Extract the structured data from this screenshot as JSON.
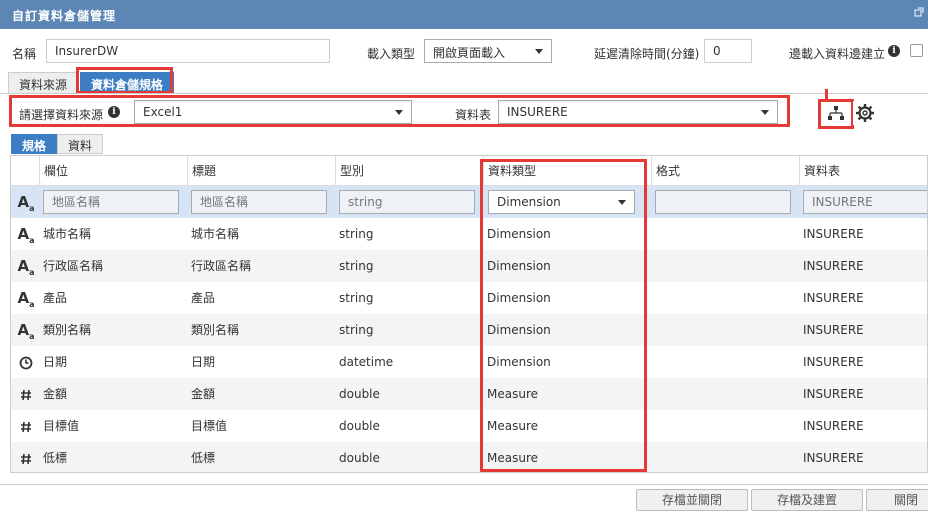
{
  "window": {
    "title": "自訂資料倉儲管理"
  },
  "form": {
    "name_label": "名稱",
    "name_value": "InsurerDW",
    "load_type_label": "載入類型",
    "load_type_value": "開啟頁面載入",
    "delay_label": "延遲清除時間(分鐘)",
    "delay_value": "0",
    "build_label": "邊載入資料邊建立",
    "build_checked": false
  },
  "tabs": [
    {
      "label": "資料來源",
      "active": false
    },
    {
      "label": "資料倉儲規格",
      "active": true
    }
  ],
  "source": {
    "select_label": "請選擇資料來源",
    "source_value": "Excel1",
    "table_label": "資料表",
    "table_value": "INSURERE"
  },
  "subtabs": [
    {
      "label": "規格",
      "active": true
    },
    {
      "label": "資料",
      "active": false
    }
  ],
  "grid": {
    "columns": [
      "欄位",
      "標題",
      "型別",
      "資料類型",
      "格式",
      "資料表"
    ],
    "filter": {
      "field": "地區名稱",
      "title": "地區名稱",
      "type": "string",
      "data_type": "Dimension",
      "format": "",
      "table": "INSURERE"
    },
    "rows": [
      {
        "icon": "text-type-icon",
        "field": "城市名稱",
        "title": "城市名稱",
        "type": "string",
        "data_type": "Dimension",
        "format": "",
        "table": "INSURERE"
      },
      {
        "icon": "text-type-icon",
        "field": "行政區名稱",
        "title": "行政區名稱",
        "type": "string",
        "data_type": "Dimension",
        "format": "",
        "table": "INSURERE"
      },
      {
        "icon": "text-type-icon",
        "field": "產品",
        "title": "產品",
        "type": "string",
        "data_type": "Dimension",
        "format": "",
        "table": "INSURERE"
      },
      {
        "icon": "text-type-icon",
        "field": "類別名稱",
        "title": "類別名稱",
        "type": "string",
        "data_type": "Dimension",
        "format": "",
        "table": "INSURERE"
      },
      {
        "icon": "clock-icon",
        "field": "日期",
        "title": "日期",
        "type": "datetime",
        "data_type": "Dimension",
        "format": "",
        "table": "INSURERE"
      },
      {
        "icon": "hash-icon",
        "field": "金額",
        "title": "金額",
        "type": "double",
        "data_type": "Measure",
        "format": "",
        "table": "INSURERE"
      },
      {
        "icon": "hash-icon",
        "field": "目標值",
        "title": "目標值",
        "type": "double",
        "data_type": "Measure",
        "format": "",
        "table": "INSURERE"
      },
      {
        "icon": "hash-icon",
        "field": "低標",
        "title": "低標",
        "type": "double",
        "data_type": "Measure",
        "format": "",
        "table": "INSURERE"
      }
    ]
  },
  "footer": {
    "save_close": "存檔並關閉",
    "save_build": "存檔及建置",
    "close": "關閉"
  },
  "colors": {
    "titlebar": "#5b86b5",
    "active_tab": "#3c7dc4",
    "highlight": "#e53935",
    "filter_row": "#d6e4f5"
  }
}
